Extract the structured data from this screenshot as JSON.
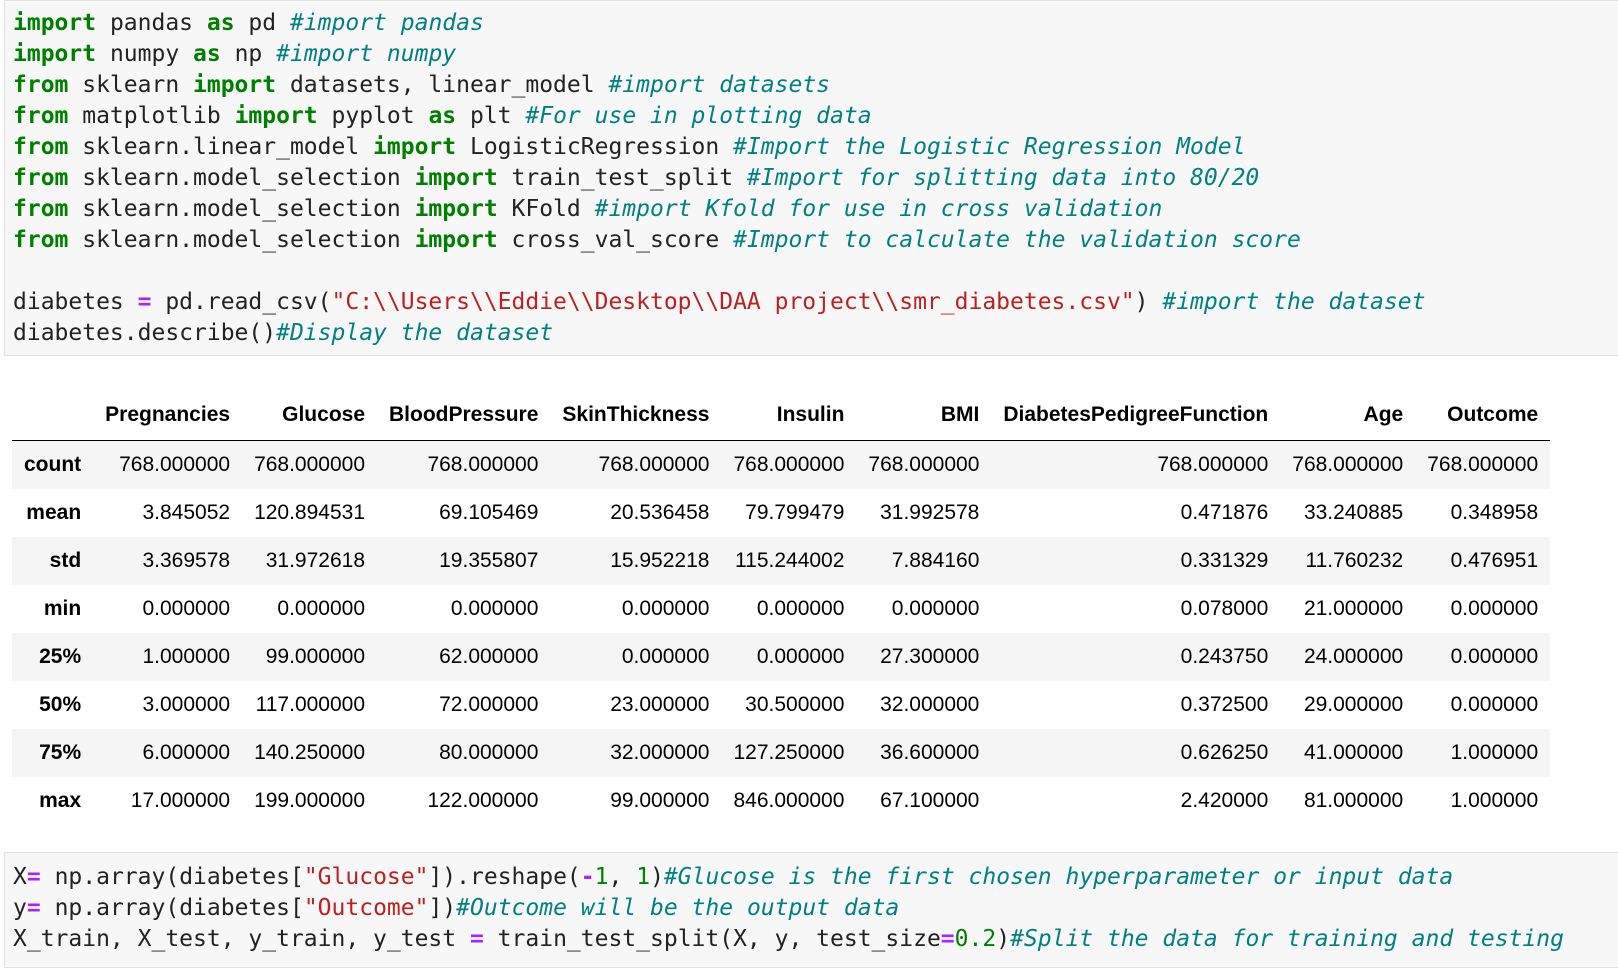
{
  "cell1": {
    "lines": [
      [
        [
          "kw",
          "import"
        ],
        [
          "t",
          " pandas "
        ],
        [
          "kw",
          "as"
        ],
        [
          "t",
          " pd "
        ],
        [
          "cm",
          "#import pandas"
        ]
      ],
      [
        [
          "kw",
          "import"
        ],
        [
          "t",
          " numpy "
        ],
        [
          "kw",
          "as"
        ],
        [
          "t",
          " np "
        ],
        [
          "cm",
          "#import numpy"
        ]
      ],
      [
        [
          "kw",
          "from"
        ],
        [
          "t",
          " sklearn "
        ],
        [
          "kw",
          "import"
        ],
        [
          "t",
          " datasets, linear_model "
        ],
        [
          "cm",
          "#import datasets"
        ]
      ],
      [
        [
          "kw",
          "from"
        ],
        [
          "t",
          " matplotlib "
        ],
        [
          "kw",
          "import"
        ],
        [
          "t",
          " pyplot "
        ],
        [
          "kw",
          "as"
        ],
        [
          "t",
          " plt "
        ],
        [
          "cm",
          "#For use in plotting data"
        ]
      ],
      [
        [
          "kw",
          "from"
        ],
        [
          "t",
          " sklearn.linear_model "
        ],
        [
          "kw",
          "import"
        ],
        [
          "t",
          " LogisticRegression "
        ],
        [
          "cm",
          "#Import the Logistic Regression Model"
        ]
      ],
      [
        [
          "kw",
          "from"
        ],
        [
          "t",
          " sklearn.model_selection "
        ],
        [
          "kw",
          "import"
        ],
        [
          "t",
          " train_test_split "
        ],
        [
          "cm",
          "#Import for splitting data into 80/20"
        ]
      ],
      [
        [
          "kw",
          "from"
        ],
        [
          "t",
          " sklearn.model_selection "
        ],
        [
          "kw",
          "import"
        ],
        [
          "t",
          " KFold "
        ],
        [
          "cm",
          "#import Kfold for use in cross validation"
        ]
      ],
      [
        [
          "kw",
          "from"
        ],
        [
          "t",
          " sklearn.model_selection "
        ],
        [
          "kw",
          "import"
        ],
        [
          "t",
          " cross_val_score "
        ],
        [
          "cm",
          "#Import to calculate the validation score"
        ]
      ],
      [],
      [
        [
          "t",
          "diabetes "
        ],
        [
          "op",
          "="
        ],
        [
          "t",
          " pd.read_csv("
        ],
        [
          "st",
          "\"C:\\\\Users\\\\Eddie\\\\Desktop\\\\DAA project\\\\smr_diabetes.csv\""
        ],
        [
          "t",
          ") "
        ],
        [
          "cm",
          "#import the dataset"
        ]
      ],
      [
        [
          "t",
          "diabetes.describe()"
        ],
        [
          "cm",
          "#Display the dataset"
        ]
      ]
    ]
  },
  "table": {
    "columns": [
      "",
      "Pregnancies",
      "Glucose",
      "BloodPressure",
      "SkinThickness",
      "Insulin",
      "BMI",
      "DiabetesPedigreeFunction",
      "Age",
      "Outcome"
    ],
    "rows": [
      {
        "label": "count",
        "values": [
          "768.000000",
          "768.000000",
          "768.000000",
          "768.000000",
          "768.000000",
          "768.000000",
          "768.000000",
          "768.000000",
          "768.000000"
        ]
      },
      {
        "label": "mean",
        "values": [
          "3.845052",
          "120.894531",
          "69.105469",
          "20.536458",
          "79.799479",
          "31.992578",
          "0.471876",
          "33.240885",
          "0.348958"
        ]
      },
      {
        "label": "std",
        "values": [
          "3.369578",
          "31.972618",
          "19.355807",
          "15.952218",
          "115.244002",
          "7.884160",
          "0.331329",
          "11.760232",
          "0.476951"
        ]
      },
      {
        "label": "min",
        "values": [
          "0.000000",
          "0.000000",
          "0.000000",
          "0.000000",
          "0.000000",
          "0.000000",
          "0.078000",
          "21.000000",
          "0.000000"
        ]
      },
      {
        "label": "25%",
        "values": [
          "1.000000",
          "99.000000",
          "62.000000",
          "0.000000",
          "0.000000",
          "27.300000",
          "0.243750",
          "24.000000",
          "0.000000"
        ]
      },
      {
        "label": "50%",
        "values": [
          "3.000000",
          "117.000000",
          "72.000000",
          "23.000000",
          "30.500000",
          "32.000000",
          "0.372500",
          "29.000000",
          "0.000000"
        ]
      },
      {
        "label": "75%",
        "values": [
          "6.000000",
          "140.250000",
          "80.000000",
          "32.000000",
          "127.250000",
          "36.600000",
          "0.626250",
          "41.000000",
          "1.000000"
        ]
      },
      {
        "label": "max",
        "values": [
          "17.000000",
          "199.000000",
          "122.000000",
          "99.000000",
          "846.000000",
          "67.100000",
          "2.420000",
          "81.000000",
          "1.000000"
        ]
      }
    ]
  },
  "cell2": {
    "lines": [
      [
        [
          "t",
          "X"
        ],
        [
          "op",
          "="
        ],
        [
          "t",
          " np.array(diabetes["
        ],
        [
          "st",
          "\"Glucose\""
        ],
        [
          "t",
          "]).reshape("
        ],
        [
          "op",
          "-"
        ],
        [
          "nm",
          "1"
        ],
        [
          "t",
          ", "
        ],
        [
          "nm",
          "1"
        ],
        [
          "t",
          ")"
        ],
        [
          "cm",
          "#Glucose is the first chosen hyperparameter or input data"
        ]
      ],
      [
        [
          "t",
          "y"
        ],
        [
          "op",
          "="
        ],
        [
          "t",
          " np.array(diabetes["
        ],
        [
          "st",
          "\"Outcome\""
        ],
        [
          "t",
          "])"
        ],
        [
          "cm",
          "#Outcome will be the output data"
        ]
      ],
      [
        [
          "t",
          "X_train, X_test, y_train, y_test "
        ],
        [
          "op",
          "="
        ],
        [
          "t",
          " train_test_split(X, y, test_size"
        ],
        [
          "op",
          "="
        ],
        [
          "nm",
          "0.2"
        ],
        [
          "t",
          ")"
        ],
        [
          "cm",
          "#Split the data for training and testing"
        ]
      ]
    ]
  }
}
